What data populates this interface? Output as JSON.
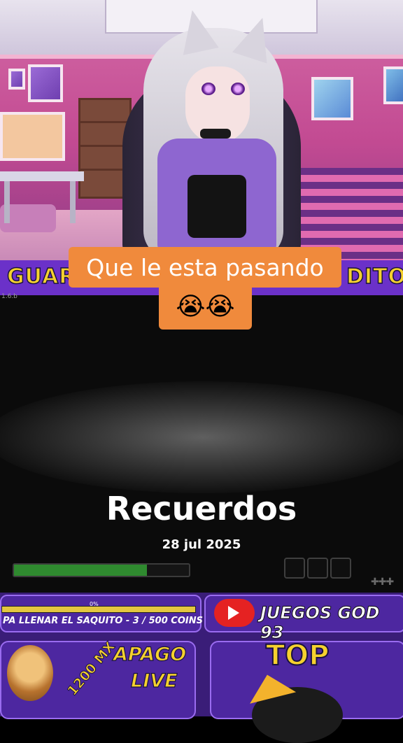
{
  "caption": {
    "line1": "Que le esta pasando",
    "emoji": "😭😭"
  },
  "banner": {
    "left_text": "GUARD",
    "right_text": "DITO",
    "version": "1.6.b"
  },
  "memory": {
    "title": "Recuerdos",
    "date": "28 jul 2025"
  },
  "progress": {
    "fill_fraction": 0.76
  },
  "goal": {
    "text": "PA LLENAR EL SAQUITO - 3 / 500 COINS",
    "pct_label": "0%"
  },
  "youtube": {
    "channel": "JUEGOS GOD 93"
  },
  "promo": {
    "amount": "1200 MX",
    "line1": "APAGO",
    "line2": "LIVE"
  },
  "leaderboard": {
    "label": "TOP"
  },
  "colors": {
    "caption_bg": "#f08a3c",
    "banner_bg": "#6b31c9",
    "banner_text": "#f5d12e",
    "progress_fill": "#2f8a2f"
  },
  "icons": [
    "youtube-icon",
    "crown-icon",
    "lion-avatar-icon",
    "plus-icon"
  ]
}
